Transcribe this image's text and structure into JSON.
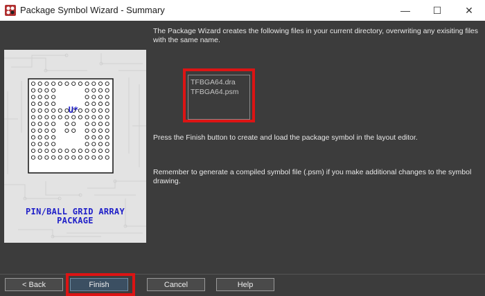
{
  "window": {
    "title": "Package Symbol Wizard - Summary",
    "controls": {
      "minimize": "—",
      "maximize": "☐",
      "close": "✕"
    }
  },
  "preview": {
    "refdes": "U*",
    "package_label_line1": "PIN/BALL GRID ARRAY",
    "package_label_line2": "PACKAGE",
    "label_color": "#2020c8"
  },
  "content": {
    "intro_text": "The Package Wizard creates the following files in your current directory, overwriting any exisiting files with the same name.",
    "files": [
      "TFBGA64.dra",
      "TFBGA64.psm"
    ],
    "finish_text": "Press the Finish button to create and load the package symbol in the layout editor.",
    "reminder_text": "Remember to generate a compiled symbol file (.psm) if you make additional changes to the symbol drawing."
  },
  "buttons": {
    "back": "< Back",
    "finish": "Finish",
    "cancel": "Cancel",
    "help": "Help"
  },
  "colors": {
    "background": "#3c3c3c",
    "highlight": "#dc1414"
  }
}
